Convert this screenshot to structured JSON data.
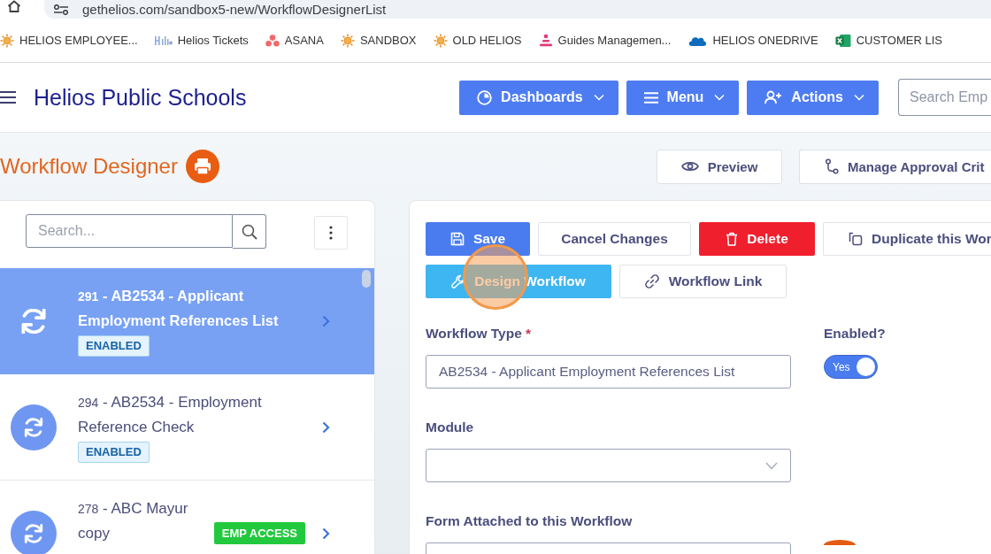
{
  "browser": {
    "url": "gethelios.com/sandbox5-new/WorkflowDesignerList",
    "bookmarks": [
      {
        "label": "HELIOS EMPLOYEE...",
        "kind": "sun"
      },
      {
        "label": "Helios Tickets",
        "kind": "logo"
      },
      {
        "label": "ASANA",
        "kind": "dots"
      },
      {
        "label": "SANDBOX",
        "kind": "sun"
      },
      {
        "label": "OLD HELIOS",
        "kind": "sun"
      },
      {
        "label": "Guides Managemen...",
        "kind": "bars"
      },
      {
        "label": "HELIOS ONEDRIVE",
        "kind": "cloud"
      },
      {
        "label": "CUSTOMER LIS",
        "kind": "sheet"
      }
    ]
  },
  "header": {
    "title": "Helios Public Schools",
    "nav": [
      {
        "label": "Dashboards",
        "kind": "dashboards"
      },
      {
        "label": "Menu",
        "kind": "menu"
      },
      {
        "label": "Actions",
        "kind": "actions"
      }
    ],
    "search": {
      "placeholder": "Search Emp"
    }
  },
  "page": {
    "title": "Workflow Designer",
    "actions": [
      {
        "label": "Preview",
        "kind": "preview"
      },
      {
        "label": "Manage Approval Crit",
        "kind": "approval"
      }
    ]
  },
  "sidebar": {
    "search": {
      "placeholder": "Search..."
    },
    "items": [
      {
        "number": "291",
        "title": "- AB2534 - Applicant Employment References List",
        "status": "ENABLED",
        "selected": true
      },
      {
        "number": "294",
        "title": "- AB2534 - Employment Reference Check",
        "status": "ENABLED",
        "selected": false
      },
      {
        "number": "278",
        "title": "- ABC Mayur copy",
        "tag": "EMP ACCESS",
        "selected": false
      }
    ]
  },
  "editor": {
    "button_rows": [
      [
        {
          "label": "Save",
          "kind": "save",
          "highlighted": false
        },
        {
          "label": "Cancel Changes",
          "kind": "cancel",
          "highlighted": false
        },
        {
          "label": "Delete",
          "kind": "delete",
          "highlighted": false
        },
        {
          "label": "Duplicate this Wor",
          "kind": "duplicate",
          "highlighted": false
        }
      ],
      [
        {
          "label": "Design Workflow",
          "kind": "design",
          "highlighted": true
        },
        {
          "label": "Workflow Link",
          "kind": "link",
          "highlighted": false
        }
      ]
    ],
    "form_rows": [
      [
        {
          "label": "Workflow Type",
          "required_mark": "*",
          "kind": "text",
          "value": "AB2534 - Applicant Employment References List"
        },
        {
          "label": "Enabled?",
          "kind": "toggle",
          "on": true,
          "value": "Yes"
        }
      ],
      [
        {
          "label": "Module",
          "kind": "select"
        }
      ],
      [
        {
          "label": "Form Attached to this Workflow",
          "kind": "text"
        }
      ]
    ]
  }
}
